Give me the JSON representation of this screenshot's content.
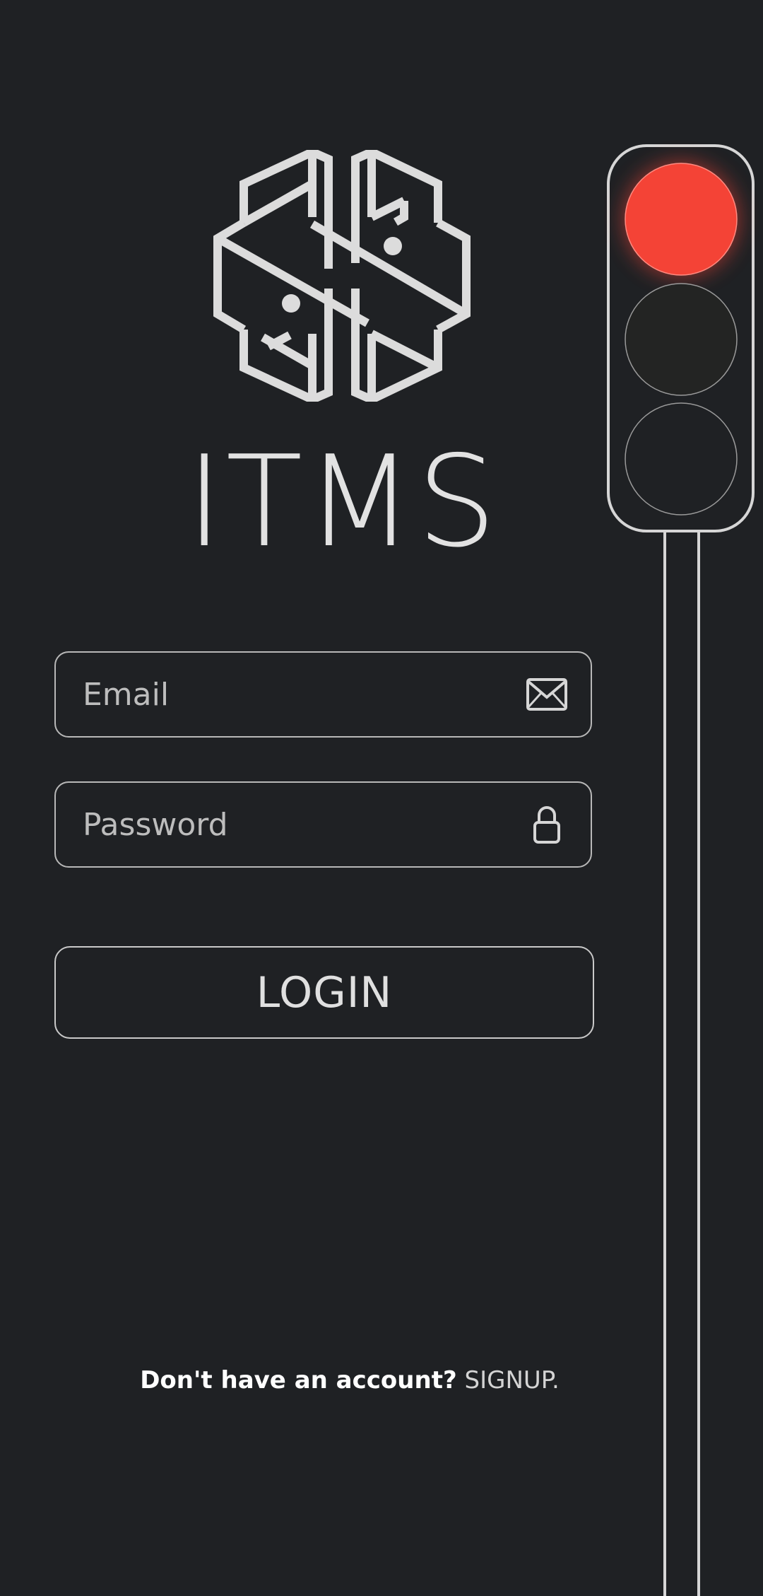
{
  "app": {
    "title": "ITMS"
  },
  "login_form": {
    "email_placeholder": "Email",
    "password_placeholder": "Password",
    "login_label": "LOGIN"
  },
  "signup": {
    "prompt": "Don't have an account?",
    "link_label": "SIGNUP."
  },
  "traffic_light": {
    "active_light": "red",
    "lights": [
      "red",
      "yellow",
      "green"
    ]
  },
  "icons": {
    "logo": "brain-circuit-logo",
    "email": "envelope-icon",
    "password": "lock-icon"
  },
  "colors": {
    "background": "#1f2124",
    "outline": "#d9d9d9",
    "red_light": "#f44336"
  }
}
